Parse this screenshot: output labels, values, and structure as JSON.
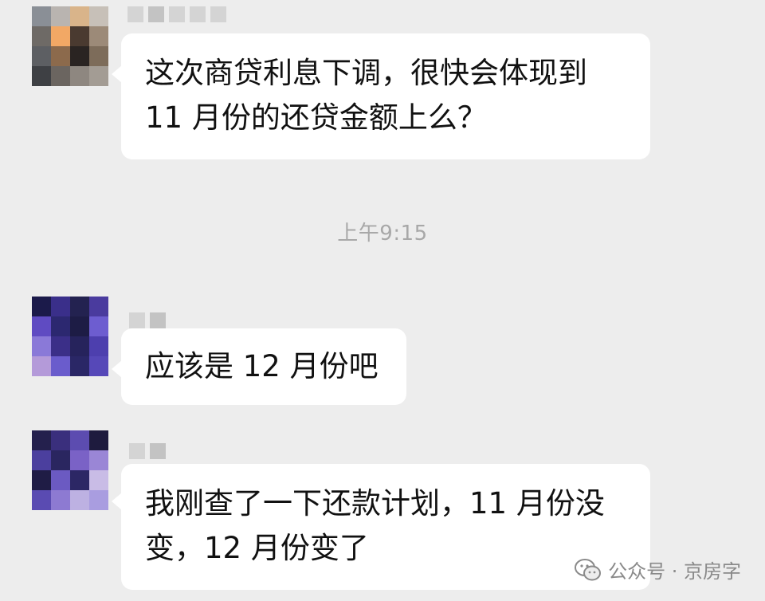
{
  "messages": [
    {
      "sender": "contact-1",
      "line1": "这次商贷利息下调，很快会体现到",
      "line2": "11 月份的还贷金额上么？"
    },
    {
      "sender": "contact-2",
      "text": "应该是 12 月份吧"
    },
    {
      "sender": "contact-3",
      "line1": "我刚查了一下还款计划，11 月份没",
      "line2": "变，12 月份变了"
    }
  ],
  "timestamp": "上午9:15",
  "watermark": {
    "text": "公众号 · 京房字",
    "icon": "wechat-icon"
  },
  "colors": {
    "background": "#ededed",
    "bubble": "#ffffff",
    "text": "#111111",
    "timestamp": "#a8a8a8"
  }
}
